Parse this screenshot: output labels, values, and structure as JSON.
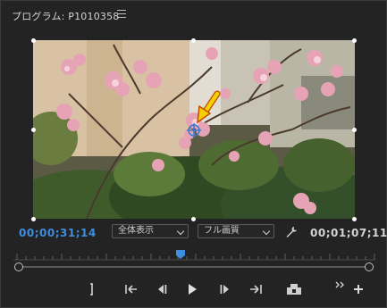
{
  "panel": {
    "title": "プログラム: P1010358",
    "menu_icon": "hamburger-menu-icon"
  },
  "timecode": {
    "current": "00;00;31;14",
    "duration": "00;01;07;11",
    "current_color": "#3d8ee0"
  },
  "zoom_dropdown": {
    "value": "全体表示"
  },
  "quality_dropdown": {
    "value": "フル画質"
  },
  "icons": {
    "settings": "wrench-icon",
    "mark_in": "mark-in-icon",
    "mark_out": "mark-out-icon",
    "go_to_in": "go-to-in-icon",
    "step_back": "step-back-icon",
    "play": "play-icon",
    "step_forward": "step-forward-icon",
    "go_to_out": "go-to-out-icon",
    "export_frame": "export-frame-icon",
    "more": "more-chevron-icon",
    "add": "add-button-icon"
  },
  "playhead": {
    "position": 0.466,
    "color": "#3d8ee0"
  },
  "annotation": {
    "arrow_color": "#f5d000"
  }
}
